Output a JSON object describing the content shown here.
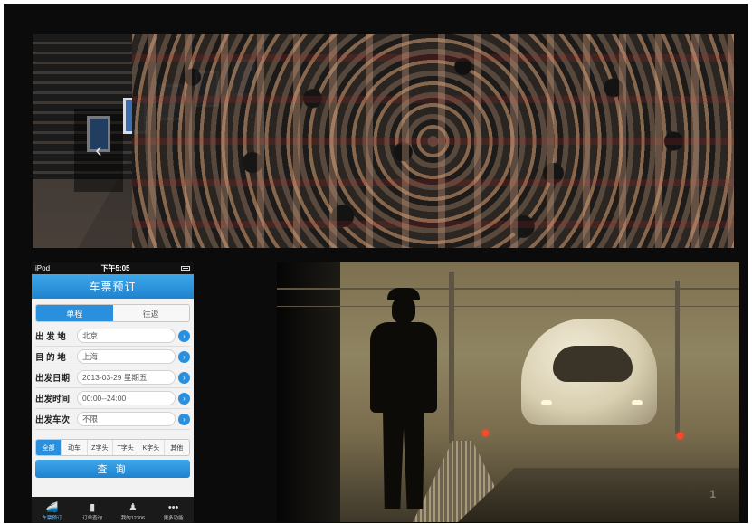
{
  "carousel": {
    "prev_label": "‹"
  },
  "phone": {
    "status": {
      "carrier": "iPod",
      "time": "下午5:05"
    },
    "title": "车票预订",
    "trip_tabs": [
      {
        "label": "单程",
        "active": true
      },
      {
        "label": "往返",
        "active": false
      }
    ],
    "rows": [
      {
        "label": "出 发 地",
        "value": "北京"
      },
      {
        "label": "目 的 地",
        "value": "上海"
      },
      {
        "label": "出发日期",
        "value": "2013-03-29 星期五"
      },
      {
        "label": "出发时间",
        "value": "00:00--24:00"
      },
      {
        "label": "出发车次",
        "value": "不限"
      }
    ],
    "train_filters": [
      "全部",
      "动车",
      "Z字头",
      "T字头",
      "K字头",
      "其他"
    ],
    "query_label": "查 询",
    "tabbar": [
      {
        "label": "车票预订",
        "icon": "train-icon",
        "active": true
      },
      {
        "label": "订单查询",
        "icon": "clipboard-icon",
        "active": false
      },
      {
        "label": "我的12306",
        "icon": "people-icon",
        "active": false
      },
      {
        "label": "更多功能",
        "icon": "more-icon",
        "active": false
      }
    ]
  },
  "scene": {
    "watermark": "1"
  },
  "colors": {
    "accent": "#2a8fdc",
    "frame": "#0b0b0b"
  }
}
